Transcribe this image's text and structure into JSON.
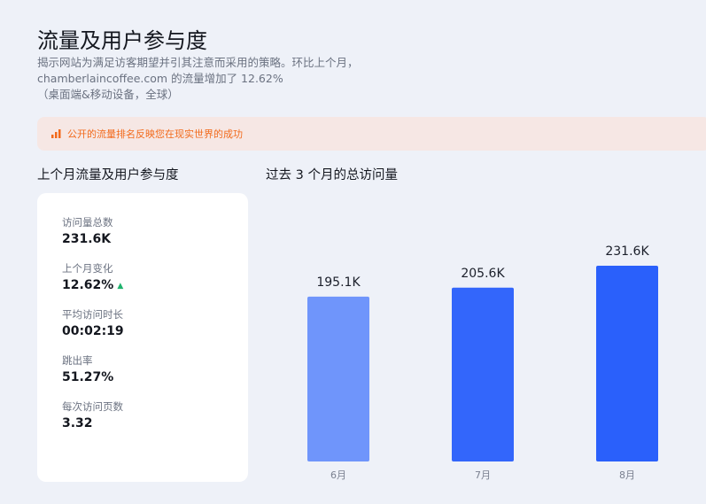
{
  "header": {
    "title": "流量及用户参与度",
    "desc_line1": "揭示网站为满足访客期望并引其注意而采用的策略。环比上个月，",
    "desc_line2": "chamberlaincoffee.com 的流量增加了 12.62%",
    "desc_line3": "（桌面端&移动设备，全球）"
  },
  "banner": {
    "text": "公开的流量排名反映您在现实世界的成功",
    "icon": "bar-chart-icon",
    "color": "#f26a1b"
  },
  "sections": {
    "left_title": "上个月流量及用户参与度",
    "right_title": "过去 3 个月的总访问量"
  },
  "metrics": [
    {
      "label": "访问量总数",
      "value": "231.6K"
    },
    {
      "label": "上个月变化",
      "value": "12.62%",
      "trend_icon": "up-arrow-icon",
      "trend_color": "#1fb36d"
    },
    {
      "label": "平均访问时长",
      "value": "00:02:19"
    },
    {
      "label": "跳出率",
      "value": "51.27%"
    },
    {
      "label": "每次访问页数",
      "value": "3.32"
    }
  ],
  "chart_data": {
    "type": "bar",
    "categories": [
      "6月",
      "7月",
      "8月"
    ],
    "values": [
      195.1,
      205.6,
      231.6
    ],
    "data_labels": [
      "195.1K",
      "205.6K",
      "231.6K"
    ],
    "unit": "K",
    "title": "过去 3 个月的总访问量",
    "xlabel": "",
    "ylabel": "",
    "ylim": [
      0,
      231.6
    ],
    "grid": false,
    "legend": "none",
    "bar_colors": [
      "#6f95fb",
      "#3366fb",
      "#2a60fb"
    ]
  }
}
